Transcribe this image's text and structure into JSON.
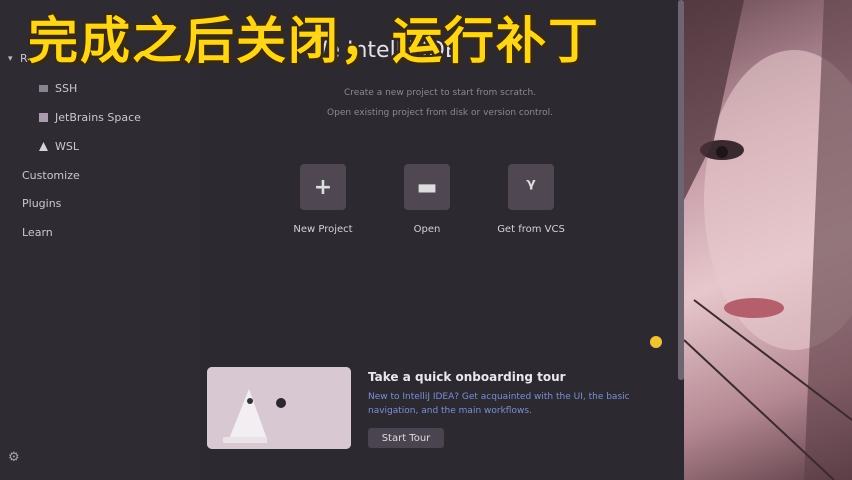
{
  "banner": {
    "text": "完成之后关闭，运行补丁"
  },
  "sidebar": {
    "group_label": "Re",
    "items": [
      {
        "label": "SSH",
        "icon": "ssh-icon"
      },
      {
        "label": "JetBrains Space",
        "icon": "space-icon"
      },
      {
        "label": "WSL",
        "icon": "linux-icon"
      }
    ],
    "top_items": [
      "Customize",
      "Plugins",
      "Learn"
    ]
  },
  "welcome": {
    "title": "We        IntelliJ IDE",
    "line1": "Create a new project to start from scratch.",
    "line2": "Open existing project from disk or version control."
  },
  "actions": [
    {
      "label": "New Project",
      "glyph": "+"
    },
    {
      "label": "Open",
      "glyph": "▬"
    },
    {
      "label": "Get from VCS",
      "glyph": "ᵞ"
    }
  ],
  "tour": {
    "title": "Take a quick onboarding tour",
    "description": "New to IntelliJ IDEA? Get acquainted with the UI, the basic navigation, and the main workflows.",
    "button": "Start Tour"
  },
  "colors": {
    "accent": "#ffd51a",
    "link": "#7b8fd6",
    "background": "#2b2830"
  }
}
